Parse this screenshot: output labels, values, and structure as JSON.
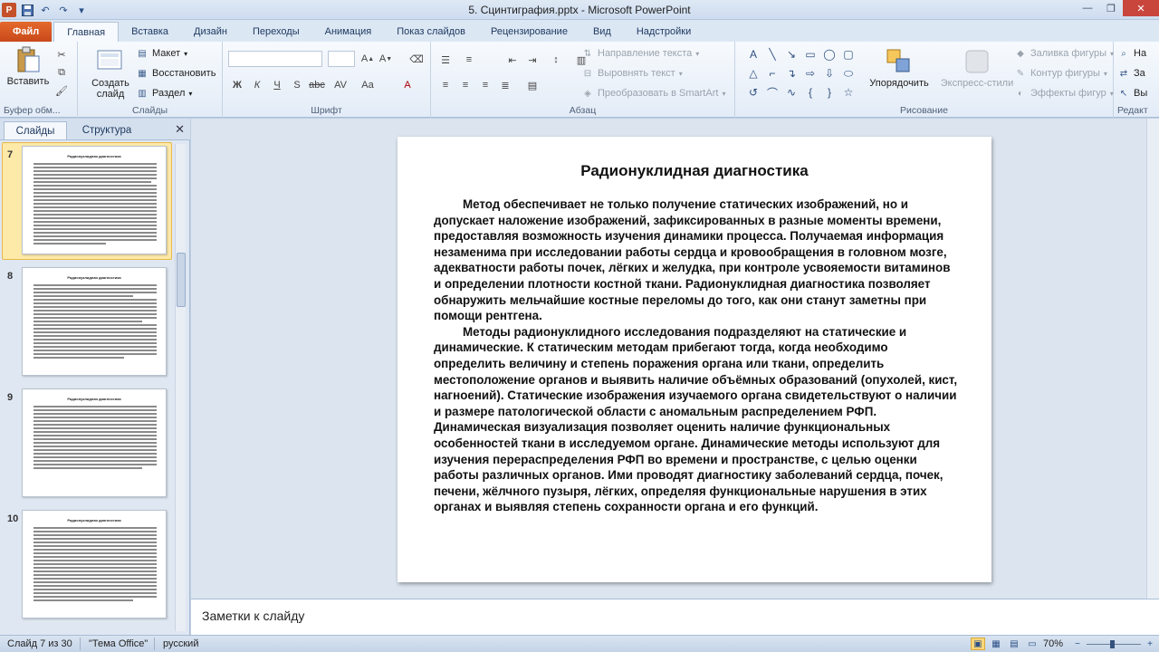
{
  "window": {
    "title": "5. Сцинтиграфия.pptx - Microsoft PowerPoint"
  },
  "tabs": [
    {
      "label": "Файл",
      "kind": "file"
    },
    {
      "label": "Главная",
      "kind": "active"
    },
    {
      "label": "Вставка"
    },
    {
      "label": "Дизайн"
    },
    {
      "label": "Переходы"
    },
    {
      "label": "Анимация"
    },
    {
      "label": "Показ слайдов"
    },
    {
      "label": "Рецензирование"
    },
    {
      "label": "Вид"
    },
    {
      "label": "Надстройки"
    }
  ],
  "ribbon": {
    "clipboard": {
      "paste": "Вставить",
      "label": "Буфер обм..."
    },
    "slides": {
      "new_slide_line1": "Создать",
      "new_slide_line2": "слайд",
      "layout": "Макет",
      "reset": "Восстановить",
      "section": "Раздел",
      "label": "Слайды"
    },
    "font": {
      "label": "Шрифт"
    },
    "paragraph": {
      "text_direction": "Направление текста",
      "align_text": "Выровнять текст",
      "smartart": "Преобразовать в SmartArt",
      "label": "Абзац"
    },
    "drawing": {
      "arrange": "Упорядочить",
      "quick_styles": "Экспресс-стили",
      "shape_fill": "Заливка фигуры",
      "shape_outline": "Контур фигуры",
      "shape_effects": "Эффекты фигур",
      "label": "Рисование"
    },
    "editing": {
      "find": "На",
      "replace": "За",
      "select": "Вы",
      "label": "Редакт"
    }
  },
  "left_pane": {
    "tab_slides": "Слайды",
    "tab_outline": "Структура",
    "thumbnails": [
      {
        "number": "7",
        "title": "Радионуклидная диагностика",
        "selected": true
      },
      {
        "number": "8",
        "title": "Радионуклидная диагностика",
        "selected": false
      },
      {
        "number": "9",
        "title": "Радионуклидная диагностика",
        "selected": false
      },
      {
        "number": "10",
        "title": "Радионуклидная диагностика",
        "selected": false
      }
    ]
  },
  "slide": {
    "title": "Радионуклидная диагностика",
    "paragraphs": [
      "Метод обеспечивает не только получение статических изображений, но и допускает наложение изображений, зафиксированных в разные моменты времени, предоставляя возможность изучения динамики процесса. Получаемая информация незаменима при исследовании работы сердца и кровообращения в головном мозге, адекватности работы почек, лёгких и желудка, при контроле усвояемости витаминов и определении плотности костной ткани. Радионуклидная диагностика позволяет обнаружить мельчайшие костные переломы до того, как они станут заметны при помощи рентгена.",
      "Методы радионуклидного исследования подразделяют на статические и динамические. К статическим методам прибегают тогда, когда необходимо определить величину и степень поражения органа или ткани, определить местоположение органов и выявить наличие объёмных образований (опухолей, кист, нагноений). Статические изображения изучаемого органа свидетельствуют о наличии и размере патологической области с аномальным распределением РФП. Динамическая визуализация позволяет оценить наличие функциональных особенностей ткани в исследуемом органе. Динамические методы используют для изучения перераспределения РФП во времени и пространстве, с целью оценки работы различных органов. Ими проводят диагностику заболеваний сердца, почек, печени, жёлчного пузыря, лёгких, определяя функциональные нарушения в этих органах и выявляя степень сохранности органа и его функций."
    ]
  },
  "notes": {
    "placeholder": "Заметки к слайду"
  },
  "status": {
    "slide_counter": "Слайд 7 из 30",
    "theme": "\"Тема Office\"",
    "language": "русский",
    "zoom": "70%"
  }
}
